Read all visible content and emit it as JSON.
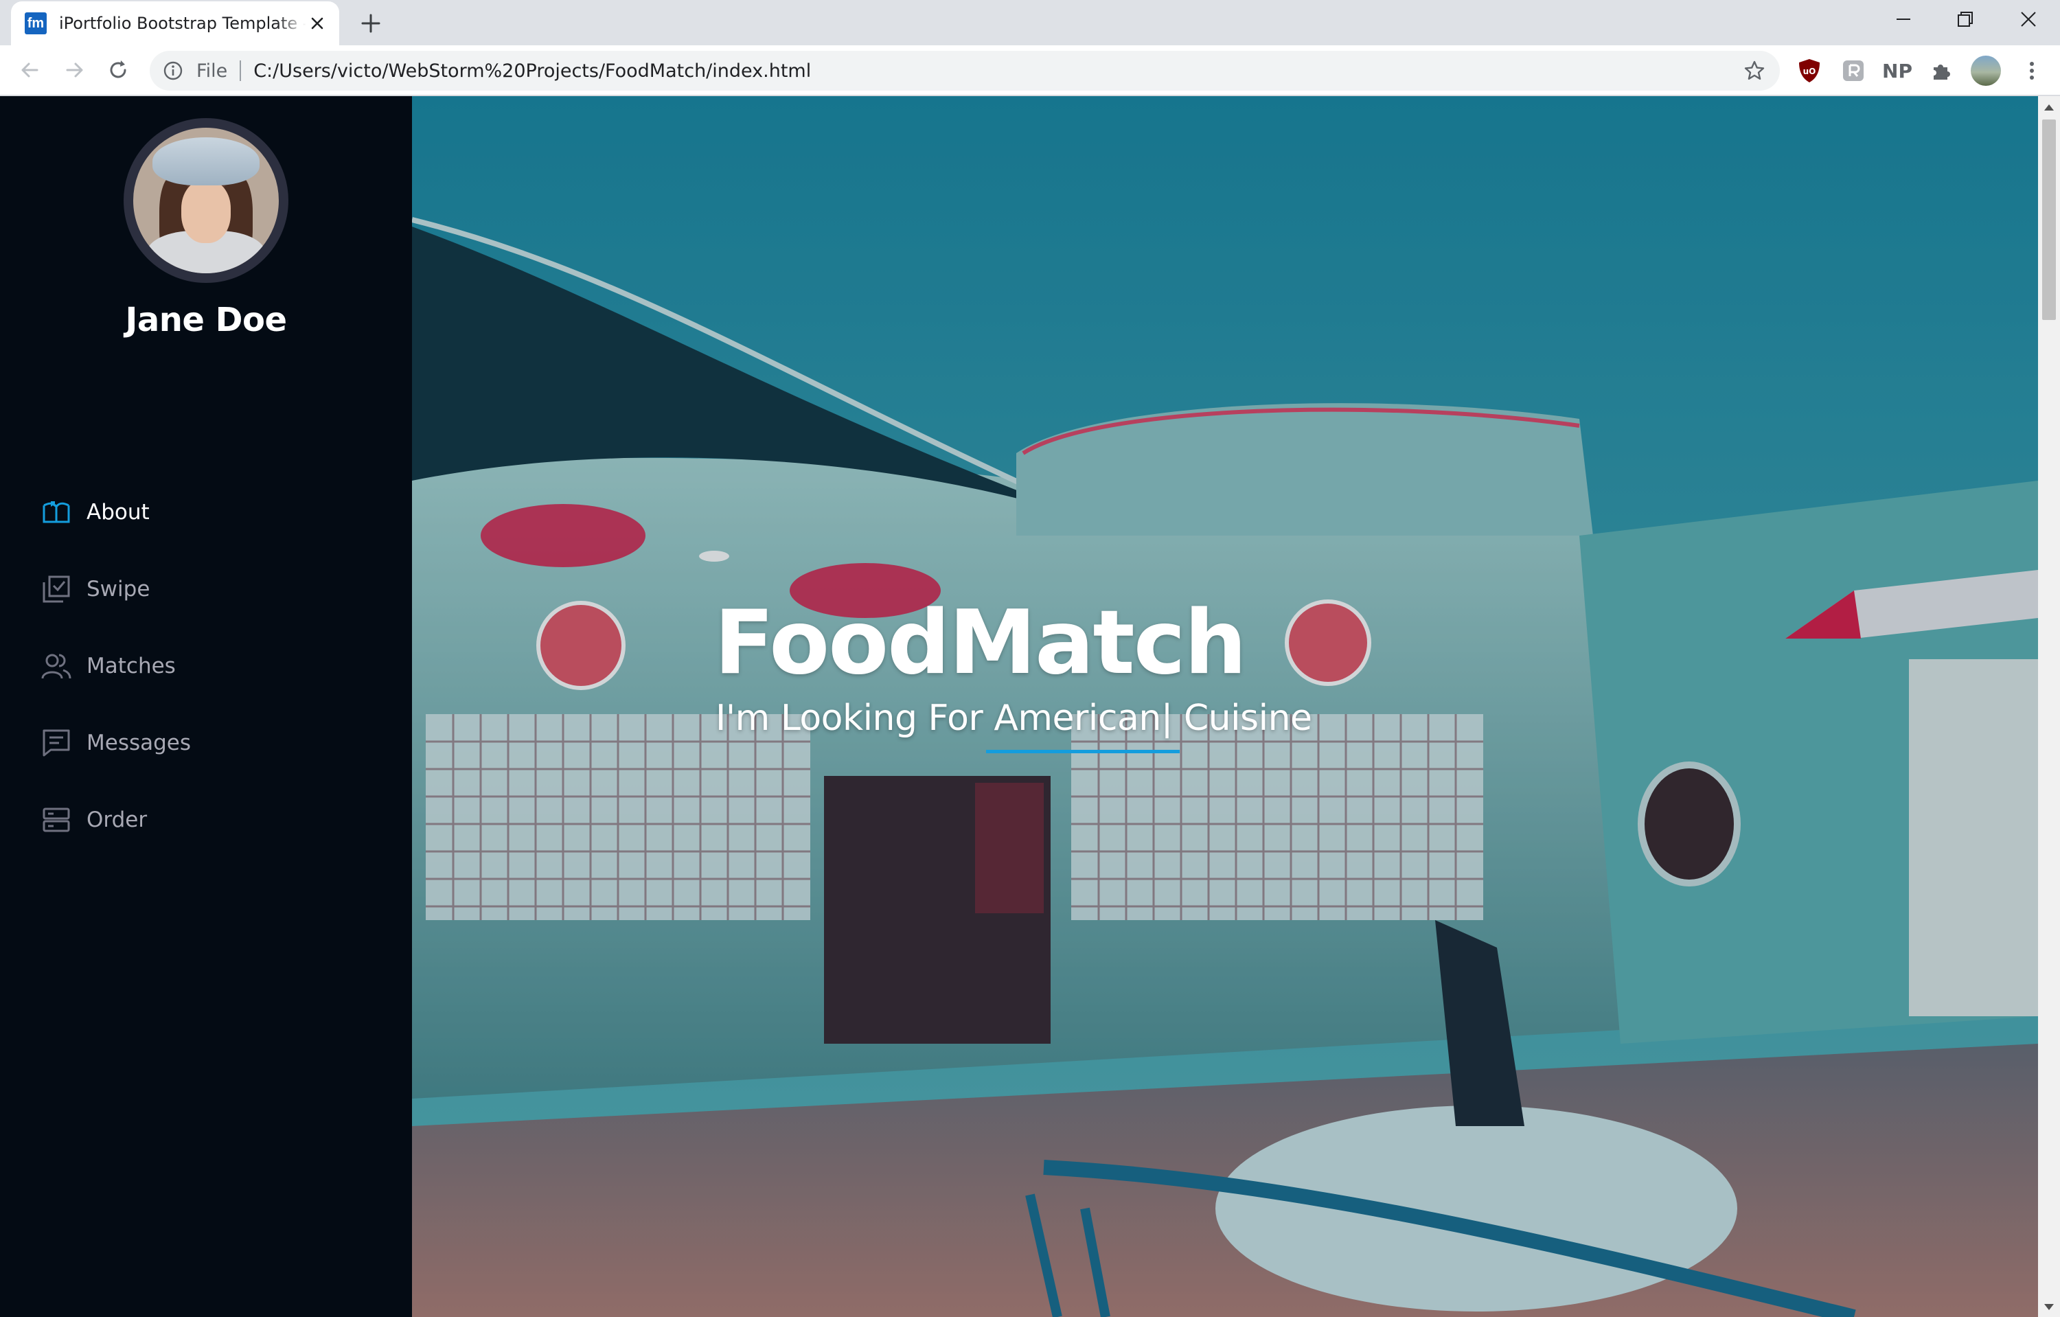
{
  "browser": {
    "tab_favicon": "fm",
    "tab_title": "iPortfolio Bootstrap Template - Index",
    "address_scheme_label": "File",
    "address_url": "C:/Users/victo/WebStorm%20Projects/FoodMatch/index.html",
    "extensions": [
      {
        "name": "ublock-icon",
        "color": "#800000"
      },
      {
        "name": "reader-icon",
        "color": "#9e9e9e"
      },
      {
        "name": "np-icon",
        "label": "NP",
        "color": "#5f6368"
      },
      {
        "name": "puzzle-icon",
        "color": "#5f6368"
      }
    ]
  },
  "sidebar": {
    "profile_name": "Jane Doe",
    "items": [
      {
        "label": "About",
        "icon": "book-icon",
        "active": true
      },
      {
        "label": "Swipe",
        "icon": "checkbox-stack-icon",
        "active": false
      },
      {
        "label": "Matches",
        "icon": "users-icon",
        "active": false
      },
      {
        "label": "Messages",
        "icon": "message-icon",
        "active": false
      },
      {
        "label": "Order",
        "icon": "server-icon",
        "active": false
      }
    ]
  },
  "hero": {
    "title": "FoodMatch",
    "subtitle": "I'm Looking For American| Cuisine"
  },
  "colors": {
    "sidebar_bg": "#040b14",
    "accent": "#149ddd",
    "nav_text": "#a8a9b4",
    "nav_active_text": "#ffffff"
  }
}
